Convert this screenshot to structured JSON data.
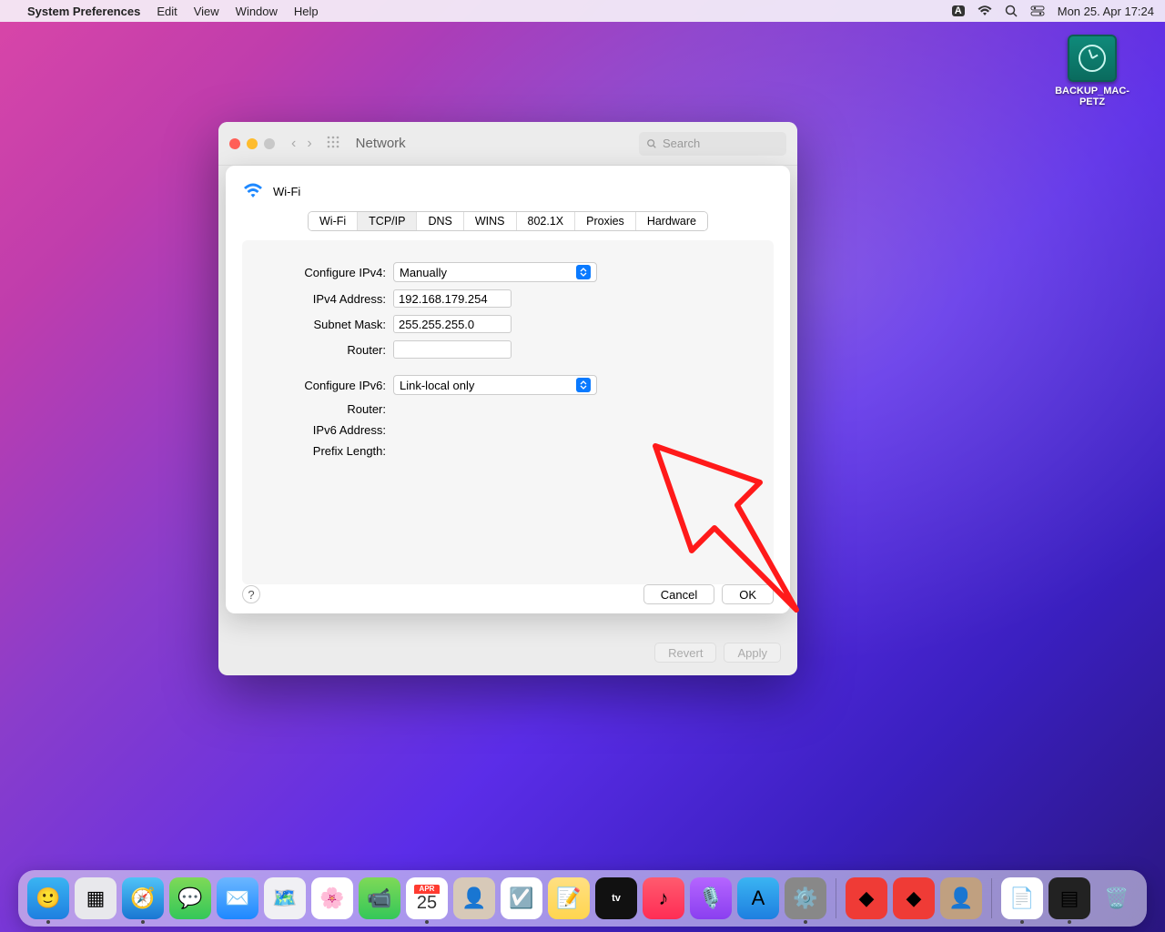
{
  "menubar": {
    "app_name": "System Preferences",
    "menus": [
      "Edit",
      "View",
      "Window",
      "Help"
    ],
    "clock": "Mon 25. Apr  17:24"
  },
  "desktop": {
    "backup_disk_label": "BACKUP_MAC-PETZ"
  },
  "window": {
    "title": "Network",
    "search_placeholder": "Search",
    "revert_label": "Revert",
    "apply_label": "Apply"
  },
  "sheet": {
    "interface": "Wi-Fi",
    "tabs": [
      "Wi-Fi",
      "TCP/IP",
      "DNS",
      "WINS",
      "802.1X",
      "Proxies",
      "Hardware"
    ],
    "active_tab": "TCP/IP",
    "form": {
      "configure_ipv4_label": "Configure IPv4:",
      "configure_ipv4_value": "Manually",
      "ipv4_address_label": "IPv4 Address:",
      "ipv4_address_value": "192.168.179.254",
      "subnet_mask_label": "Subnet Mask:",
      "subnet_mask_value": "255.255.255.0",
      "router_v4_label": "Router:",
      "router_v4_value": "",
      "configure_ipv6_label": "Configure IPv6:",
      "configure_ipv6_value": "Link-local only",
      "router_v6_label": "Router:",
      "ipv6_address_label": "IPv6 Address:",
      "prefix_length_label": "Prefix Length:"
    },
    "help_label": "?",
    "cancel_label": "Cancel",
    "ok_label": "OK"
  },
  "dock": {
    "items": [
      {
        "name": "finder",
        "bg": "linear-gradient(#3ab4f2,#1e7fe0)",
        "glyph": "🙂",
        "running": true
      },
      {
        "name": "launchpad",
        "bg": "#e8e8ec",
        "glyph": "▦"
      },
      {
        "name": "safari",
        "bg": "linear-gradient(#4fc3f7,#1976d2)",
        "glyph": "🧭",
        "running": true
      },
      {
        "name": "messages",
        "bg": "linear-gradient(#7ed957,#34c759)",
        "glyph": "💬"
      },
      {
        "name": "mail",
        "bg": "linear-gradient(#6bb7ff,#1e88ff)",
        "glyph": "✉️"
      },
      {
        "name": "maps",
        "bg": "#f0f0f4",
        "glyph": "🗺️"
      },
      {
        "name": "photos",
        "bg": "#fff",
        "glyph": "🌸"
      },
      {
        "name": "facetime",
        "bg": "linear-gradient(#7ed957,#34c759)",
        "glyph": "📹"
      },
      {
        "name": "calendar",
        "bg": "#fff",
        "glyph": "25",
        "badge": "APR",
        "running": true
      },
      {
        "name": "contacts",
        "bg": "#d7c9b8",
        "glyph": "👤"
      },
      {
        "name": "reminders",
        "bg": "#fff",
        "glyph": "☑️"
      },
      {
        "name": "notes",
        "bg": "linear-gradient(#ffe082,#ffd54f)",
        "glyph": "📝"
      },
      {
        "name": "appletv",
        "bg": "#111",
        "glyph": "tv"
      },
      {
        "name": "music",
        "bg": "linear-gradient(#ff5b6e,#ff2d55)",
        "glyph": "♪"
      },
      {
        "name": "podcasts",
        "bg": "linear-gradient(#b565ff,#8a3ff0)",
        "glyph": "🎙️"
      },
      {
        "name": "appstore",
        "bg": "linear-gradient(#3ab4f2,#1e7fe0)",
        "glyph": "A"
      },
      {
        "name": "system-preferences",
        "bg": "#888",
        "glyph": "⚙️",
        "running": true
      }
    ],
    "extras": [
      {
        "name": "anydesk-1",
        "bg": "#ef3b36",
        "glyph": "◆"
      },
      {
        "name": "anydesk-2",
        "bg": "#ef3b36",
        "glyph": "◆"
      },
      {
        "name": "user-photo",
        "bg": "#c0a080",
        "glyph": "👤"
      }
    ],
    "right": [
      {
        "name": "document",
        "bg": "#fff",
        "glyph": "📄",
        "running": true
      },
      {
        "name": "dark-app",
        "bg": "#222",
        "glyph": "▤",
        "running": true
      },
      {
        "name": "trash",
        "bg": "transparent",
        "glyph": "🗑️"
      }
    ]
  }
}
